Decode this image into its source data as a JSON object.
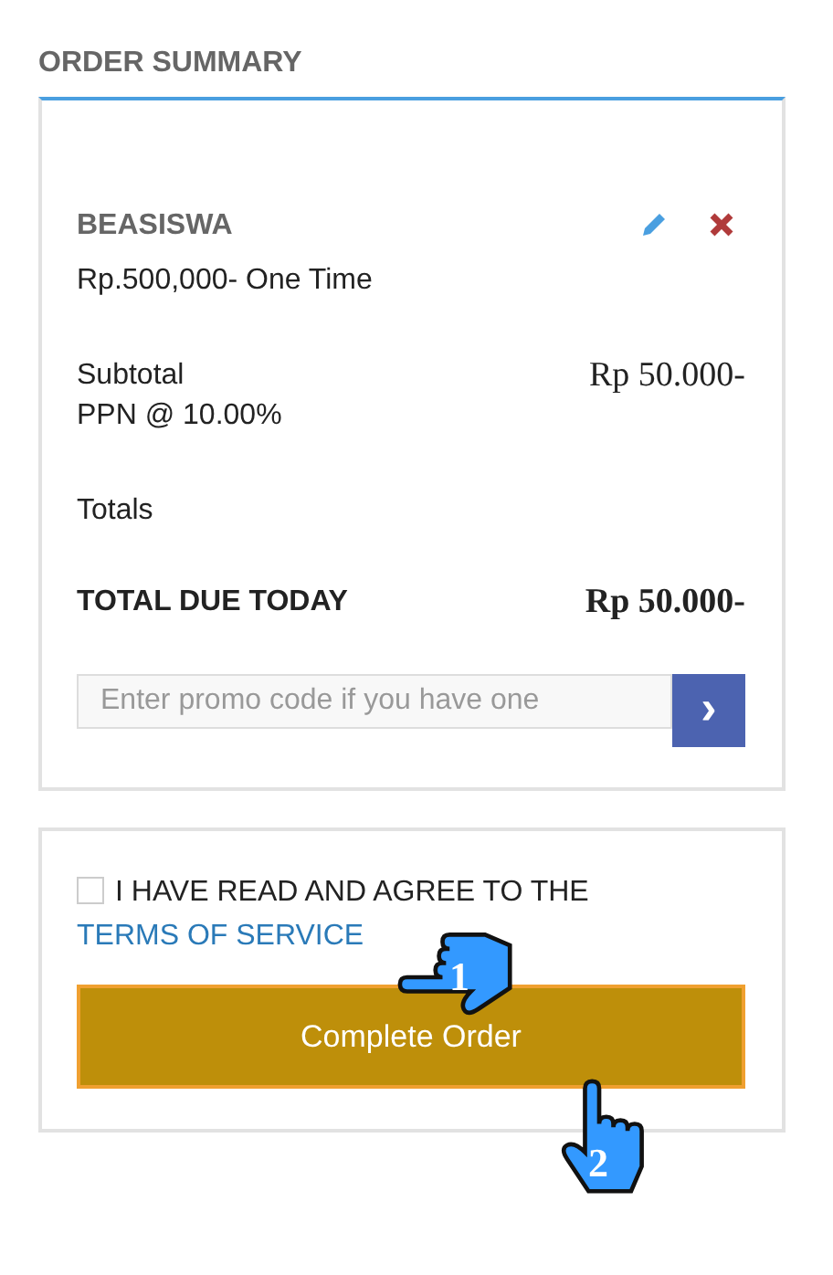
{
  "heading": "ORDER SUMMARY",
  "item": {
    "name": "BEASISWA",
    "price": "Rp.500,000- One Time"
  },
  "subtotal": {
    "label": "Subtotal",
    "amount": "Rp 50.000-"
  },
  "tax": {
    "label": "PPN @ 10.00%"
  },
  "totals": {
    "label": "Totals"
  },
  "total_due": {
    "label": "TOTAL DUE TODAY",
    "amount": "Rp 50.000-"
  },
  "promo": {
    "placeholder": "Enter promo code if you have one",
    "button": "›"
  },
  "terms": {
    "checked": false,
    "text": "I HAVE READ AND AGREE TO THE",
    "link": "TERMS OF SERVICE"
  },
  "complete_button": "Complete Order",
  "callouts": [
    {
      "number": "1",
      "kind": "left"
    },
    {
      "number": "2",
      "kind": "up"
    }
  ]
}
